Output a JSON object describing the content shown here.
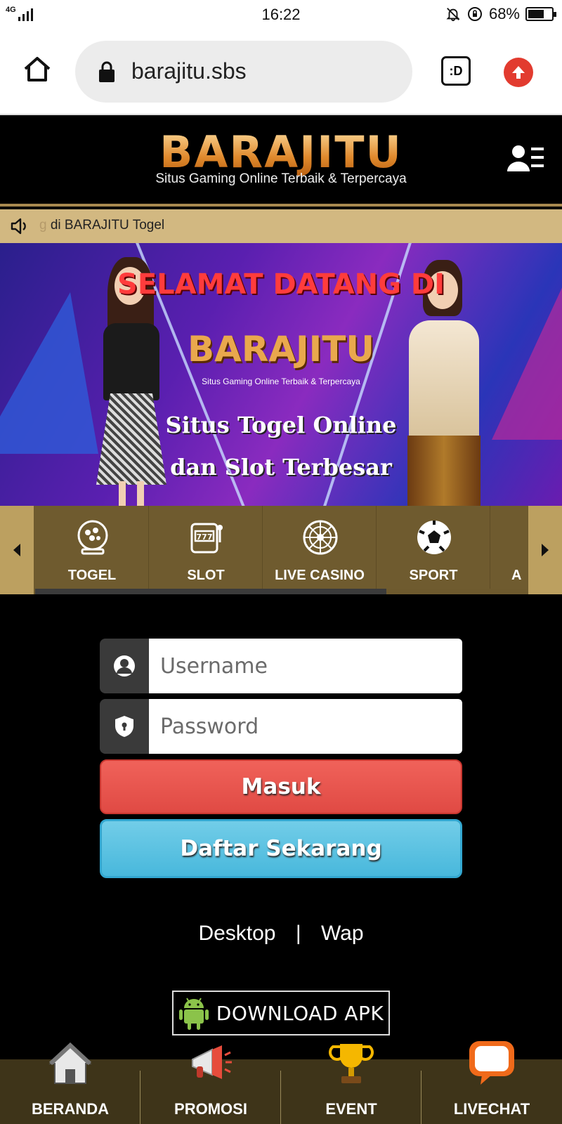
{
  "status_bar": {
    "network": "4G",
    "time": "16:22",
    "battery_percent": "68%",
    "battery_level": 0.68
  },
  "browser": {
    "url": "barajitu.sbs",
    "tab_button_label": ":D"
  },
  "header": {
    "logo_text": "BARAJITU",
    "tagline": "Situs Gaming Online Terbaik & Terpercaya"
  },
  "marquee": {
    "text_faded": "g",
    "text": "di BARAJITU Togel"
  },
  "banner": {
    "welcome": "SELAMAT DATANG DI",
    "logo_text": "BARAJITU",
    "logo_tagline": "Situs Gaming Online Terbaik & Terpercaya",
    "line1": "Situs Togel Online",
    "line2": "dan Slot Terbesar"
  },
  "categories": [
    {
      "label": "TOGEL",
      "icon": "lottery-ball-icon"
    },
    {
      "label": "SLOT",
      "icon": "slot-machine-icon"
    },
    {
      "label": "LIVE CASINO",
      "icon": "roulette-icon"
    },
    {
      "label": "SPORT",
      "icon": "soccer-ball-icon"
    },
    {
      "label": "A",
      "icon": "more-icon"
    }
  ],
  "login": {
    "username_placeholder": "Username",
    "password_placeholder": "Password",
    "login_button": "Masuk",
    "register_button": "Daftar Sekarang"
  },
  "links": {
    "desktop": "Desktop",
    "separator": "|",
    "wap": "Wap"
  },
  "download": {
    "label": "DOWNLOAD APK",
    "icon": "android-icon"
  },
  "bottom_nav": [
    {
      "label": "BERANDA",
      "icon": "home-icon"
    },
    {
      "label": "PROMOSI",
      "icon": "megaphone-icon"
    },
    {
      "label": "EVENT",
      "icon": "trophy-icon"
    },
    {
      "label": "LIVECHAT",
      "icon": "chat-icon"
    }
  ],
  "colors": {
    "header_bg": "#000000",
    "marquee_bg": "#d2b881",
    "category_bg": "#6e5a2e",
    "login_button": "#e8554f",
    "register_button": "#5cc3e2",
    "bottom_nav_bg": "#3e3419",
    "logo_gold": "#e9a84d"
  }
}
